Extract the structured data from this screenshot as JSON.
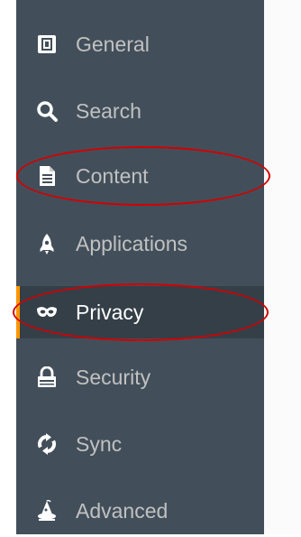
{
  "sidebar": {
    "items": [
      {
        "label": "General",
        "icon": "general-icon"
      },
      {
        "label": "Search",
        "icon": "search-icon"
      },
      {
        "label": "Content",
        "icon": "document-icon"
      },
      {
        "label": "Applications",
        "icon": "rocket-icon"
      },
      {
        "label": "Privacy",
        "icon": "mask-icon",
        "selected": true
      },
      {
        "label": "Security",
        "icon": "lock-icon"
      },
      {
        "label": "Sync",
        "icon": "sync-icon"
      },
      {
        "label": "Advanced",
        "icon": "wizard-hat-icon"
      }
    ]
  },
  "colors": {
    "sidebar_bg": "#424F5A",
    "selected_bg": "#343F48",
    "selected_accent": "#FF9500",
    "annotation": "#D40000"
  }
}
